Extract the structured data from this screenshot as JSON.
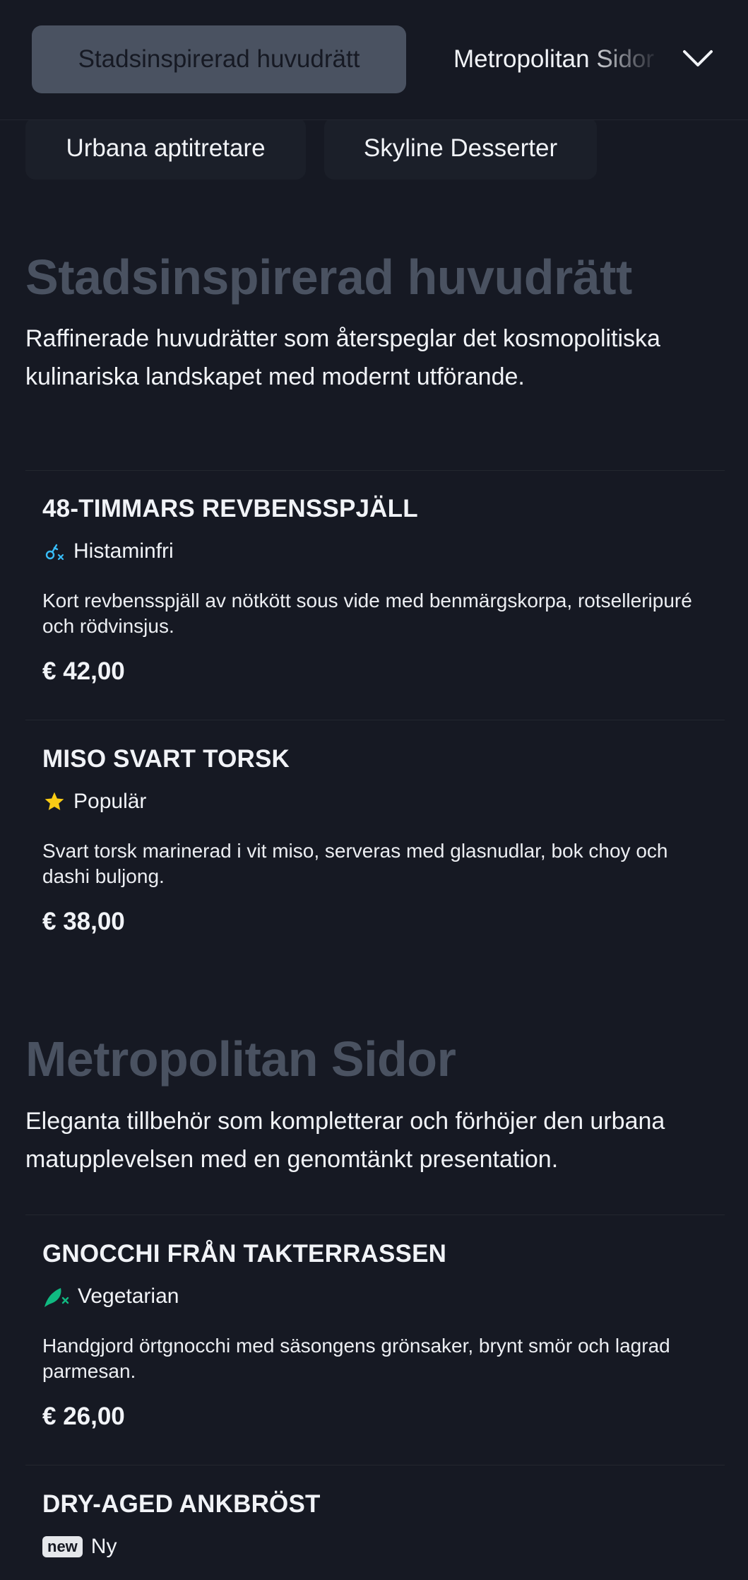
{
  "nav": {
    "active_tab": "Stadsinspirerad huvudrätt",
    "next_tab": "Metropolitan Sidor",
    "chips": [
      "Urbana aptitretare",
      "Skyline Desserter"
    ]
  },
  "sections": [
    {
      "title": "Stadsinspirerad huvudrätt",
      "description": "Raffinerade huvudrätter som återspeglar det kosmopolitiska kulinariska landskapet med modernt utförande.",
      "items": [
        {
          "name": "48-TIMMARS REVBENSSPJÄLL",
          "tag": {
            "label": "Histaminfri",
            "icon": "histamine-free-icon",
            "color": "#38bdf8"
          },
          "description": "Kort revbensspjäll av nötkött sous vide med benmärgskorpa, rotselleripuré och rödvinsjus.",
          "price": "€ 42,00"
        },
        {
          "name": "MISO SVART TORSK",
          "tag": {
            "label": "Populär",
            "icon": "star-icon",
            "color": "#facc15"
          },
          "description": "Svart torsk marinerad i vit miso, serveras med glasnudlar, bok choy och dashi buljong.",
          "price": "€ 38,00"
        }
      ]
    },
    {
      "title": "Metropolitan Sidor",
      "description": "Eleganta tillbehör som kompletterar och förhöjer den urbana matupplevelsen med en genomtänkt presentation.",
      "items": [
        {
          "name": "GNOCCHI FRÅN TAKTERRASSEN",
          "tag": {
            "label": "Vegetarian",
            "icon": "vegetarian-leaf-icon",
            "color": "#10b981"
          },
          "description": "Handgjord örtgnocchi med säsongens grönsaker, brynt smör och lagrad parmesan.",
          "price": "€ 26,00"
        },
        {
          "name": "DRY-AGED ANKBRÖST",
          "tag": {
            "label": "Ny",
            "badge": "new",
            "icon": "new-badge-icon"
          }
        }
      ]
    }
  ]
}
